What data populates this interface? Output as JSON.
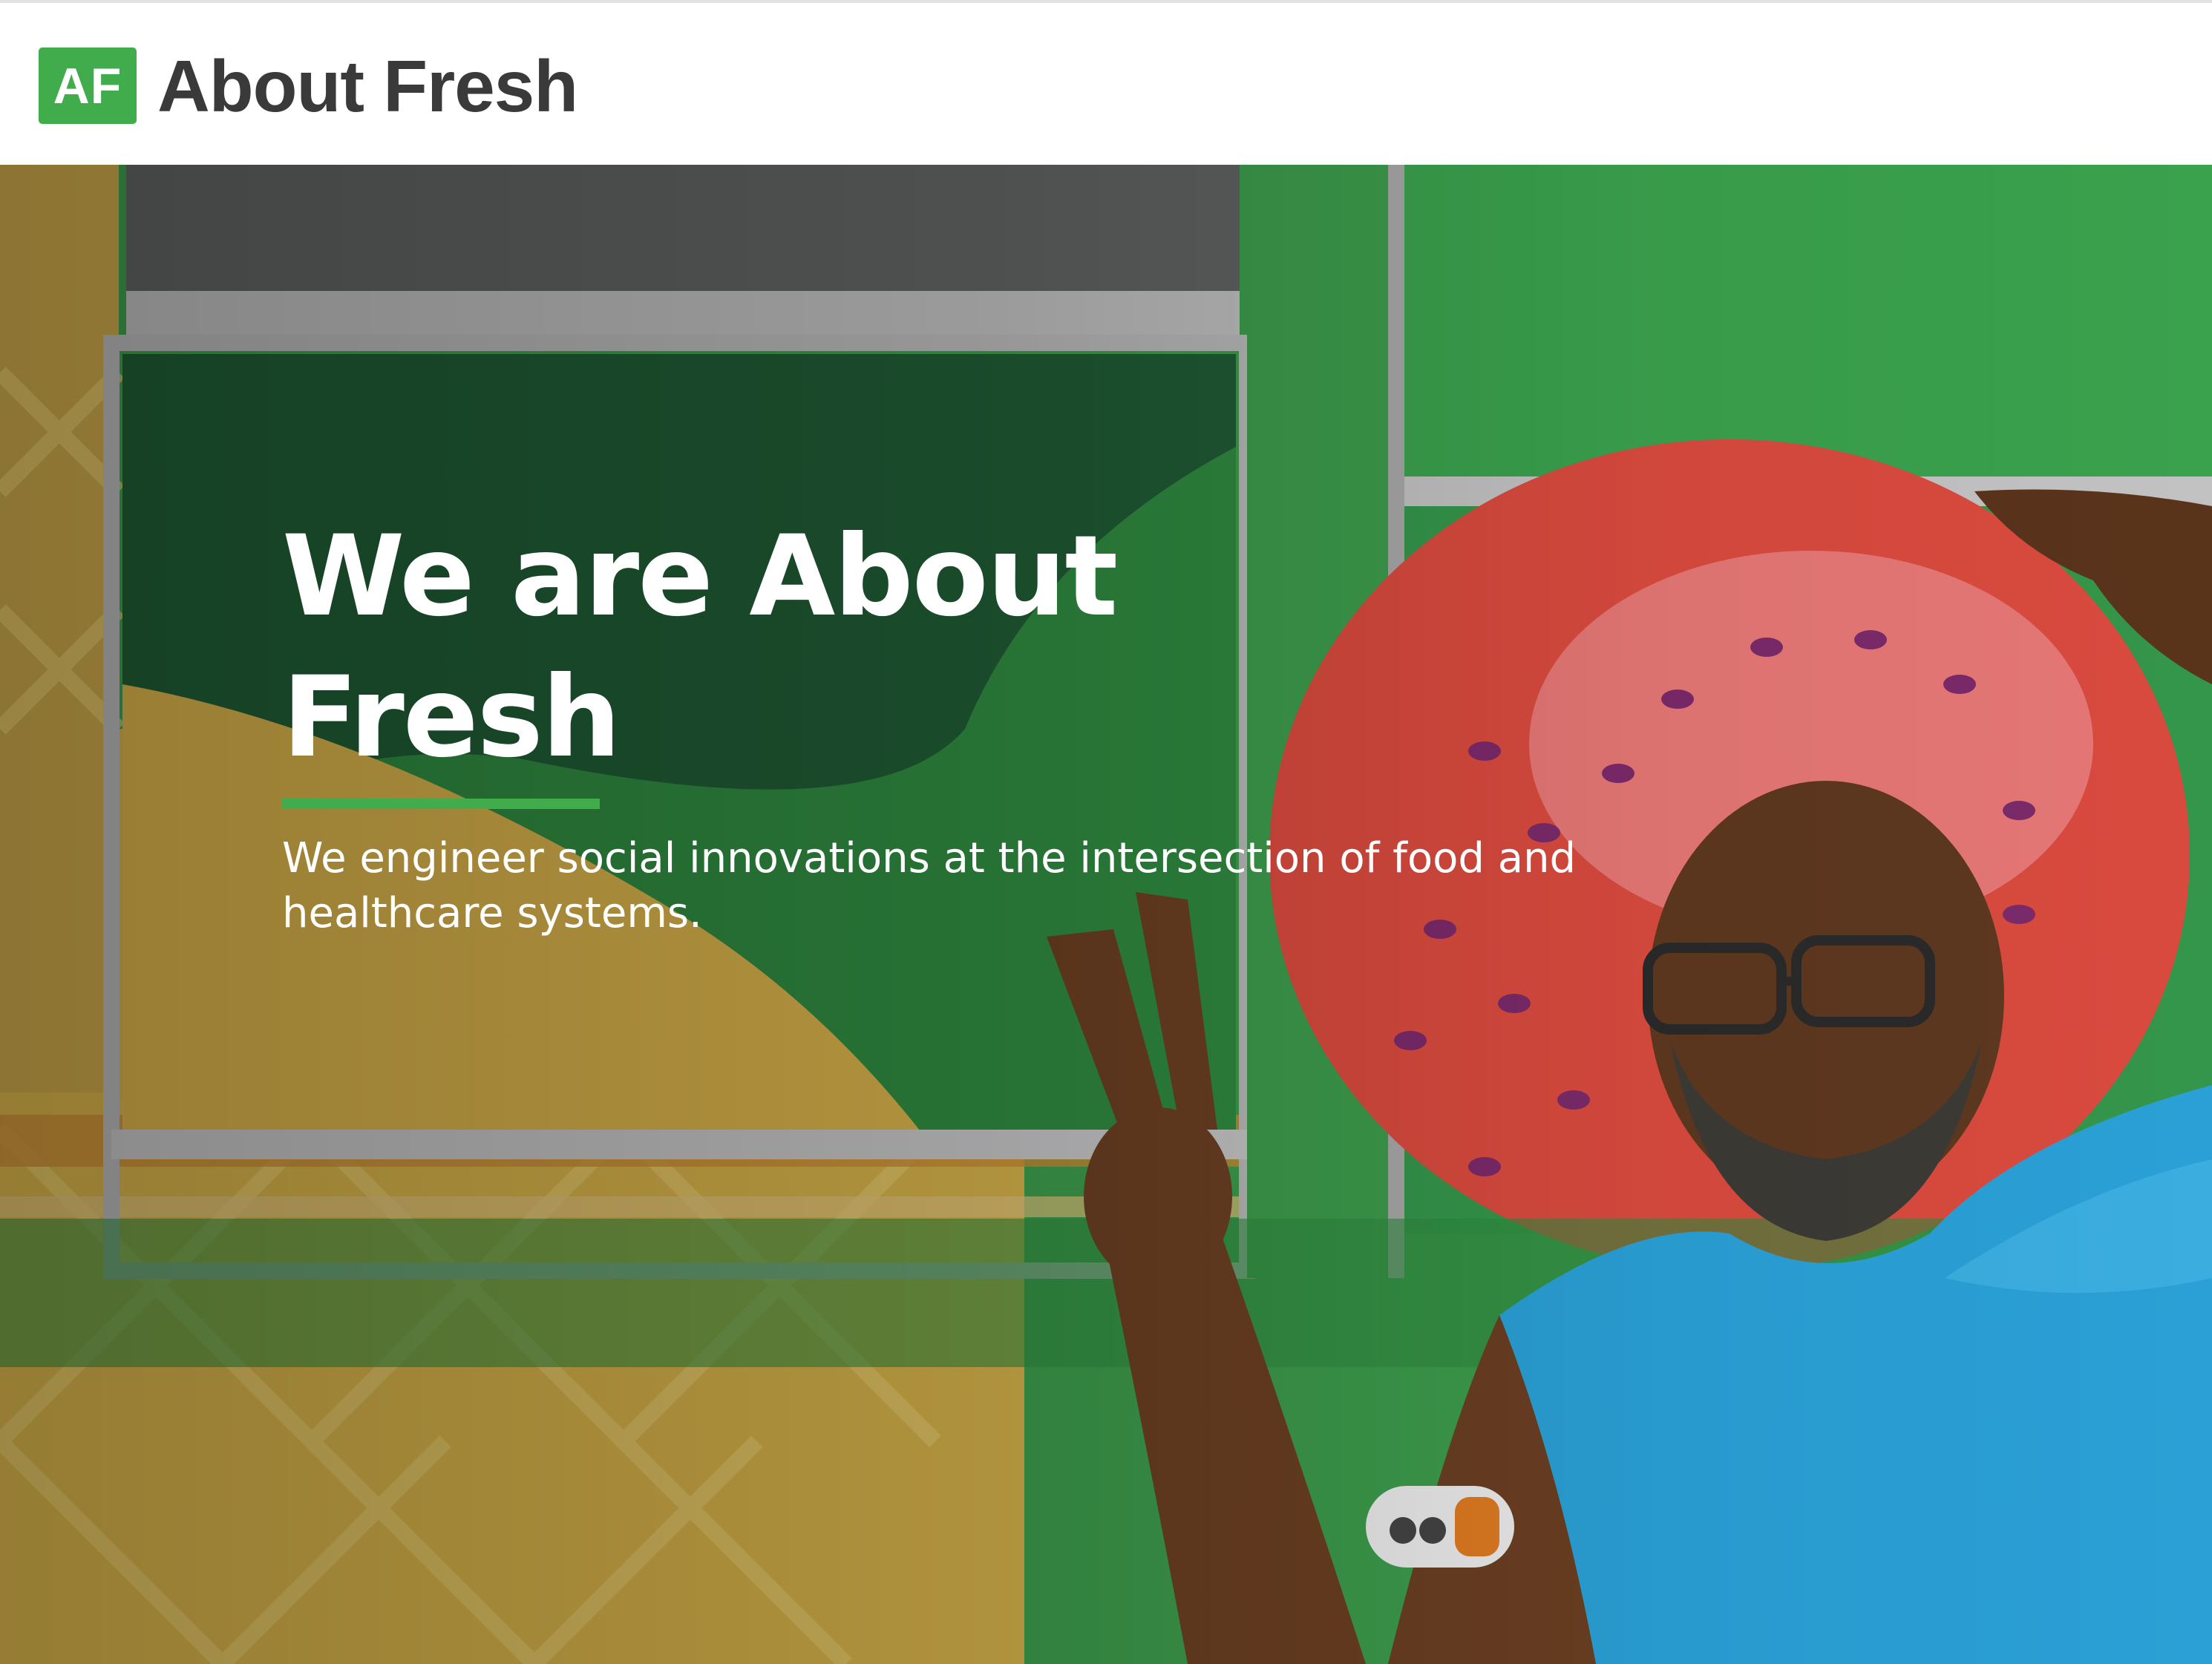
{
  "header": {
    "logo_mark": "AF",
    "logo_text": "About Fresh"
  },
  "hero": {
    "title": "We are About Fresh",
    "subtitle": "We engineer social innovations at the intersection of food and healthcare systems.",
    "image_description": "Man in blue tank top making peace sign in front of green mobile market bus painted with strawberry and pineapple",
    "colors": {
      "brand_green": "#41ac4c",
      "bus_green": "#3f9e4f",
      "shirt_blue": "#2aa0d6"
    }
  }
}
